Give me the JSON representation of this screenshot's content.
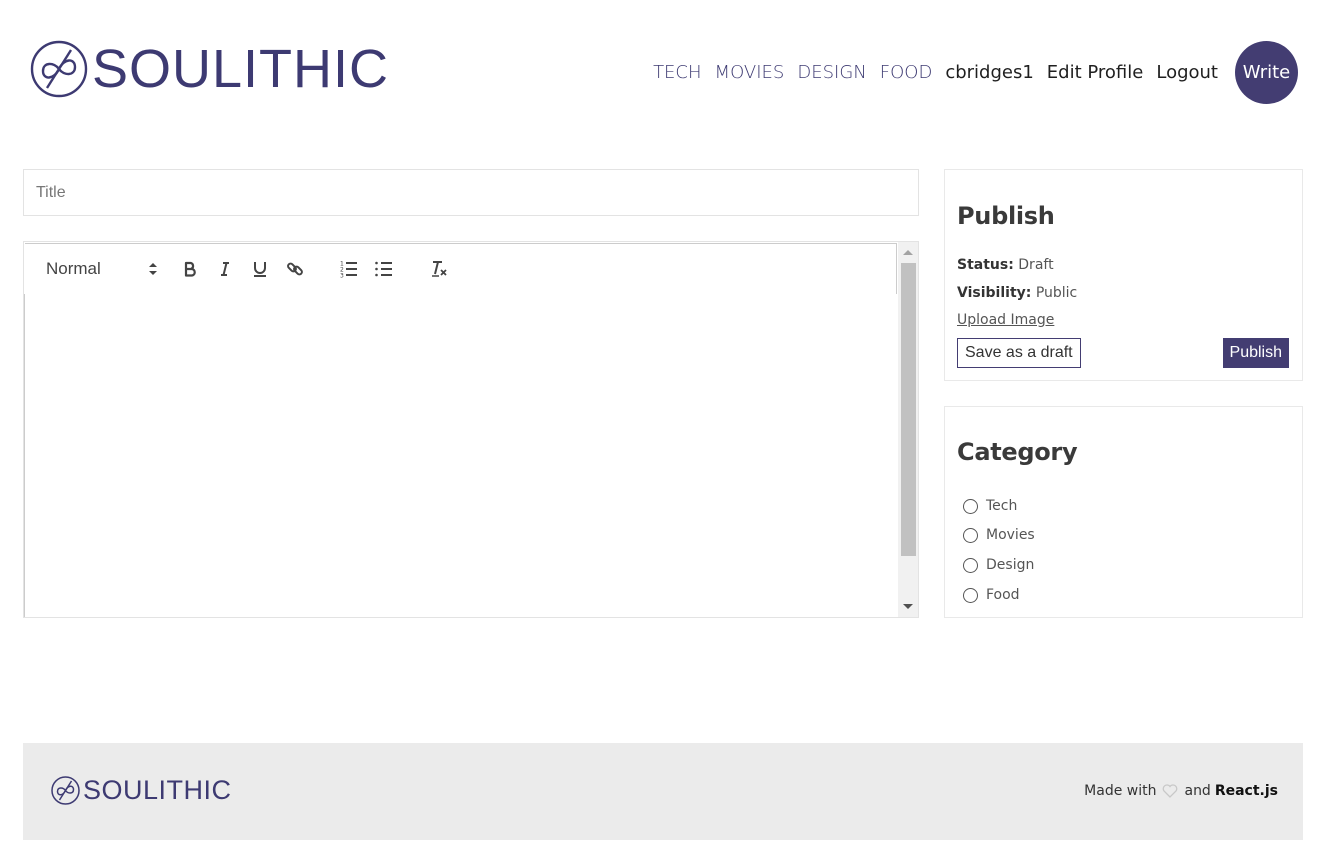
{
  "brand": {
    "name": "SOULITHIC",
    "accent": "#433d72"
  },
  "nav": {
    "categories": [
      "TECH",
      "MOVIES",
      "DESIGN",
      "FOOD"
    ],
    "username": "cbridges1",
    "edit_profile": "Edit Profile",
    "logout": "Logout",
    "write": "Write"
  },
  "editor": {
    "title_placeholder": "Title",
    "title_value": "",
    "format_select": "Normal",
    "toolbar_icons": [
      "bold-icon",
      "italic-icon",
      "underline-icon",
      "link-icon",
      "ordered-list-icon",
      "bullet-list-icon",
      "clear-format-icon"
    ]
  },
  "publish": {
    "heading": "Publish",
    "status_label": "Status:",
    "status_value": "Draft",
    "visibility_label": "Visibility:",
    "visibility_value": "Public",
    "upload_label": "Upload Image",
    "save_draft_label": "Save as a draft",
    "publish_label": "Publish"
  },
  "category": {
    "heading": "Category",
    "options": [
      "Tech",
      "Movies",
      "Design",
      "Food"
    ]
  },
  "footer": {
    "brand": "SOULITHIC",
    "made_with": "Made with",
    "and": "and",
    "tech": "React.js"
  }
}
